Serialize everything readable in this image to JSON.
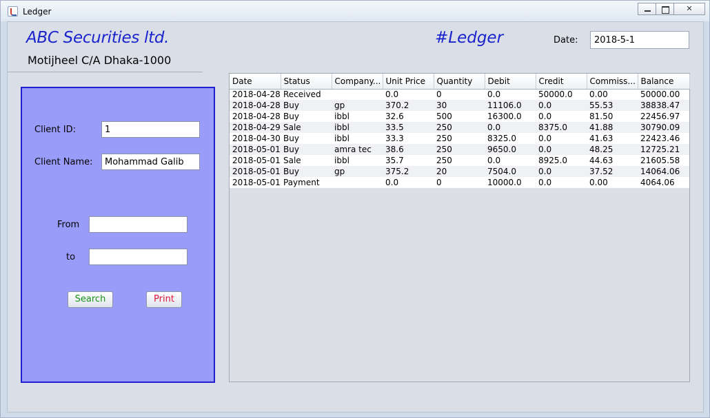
{
  "window": {
    "title": "Ledger"
  },
  "header": {
    "company_name": "ABC Securities ltd.",
    "company_address": "Motijheel C/A Dhaka-1000",
    "screen_title": "#Ledger",
    "date_label": "Date:",
    "date_value": "2018-5-1"
  },
  "form": {
    "client_id_label": "Client ID:",
    "client_id_value": "1",
    "client_name_label": "Client Name:",
    "client_name_value": "Mohammad Galib",
    "from_label": "From",
    "from_value": "",
    "to_label": "to",
    "to_value": "",
    "search_label": "Search",
    "print_label": "Print"
  },
  "colors": {
    "brand_blue": "#1a23cc",
    "panel_bg": "#9a9cf9",
    "search_green": "#1a8f1a",
    "print_red": "#e0143c"
  },
  "table": {
    "columns": [
      "Date",
      "Status",
      "Company...",
      "Unit Price",
      "Quantity",
      "Debit",
      "Credit",
      "Commiss...",
      "Balance"
    ],
    "rows": [
      [
        "2018-04-28",
        "Received",
        "",
        "0.0",
        "0",
        "0.0",
        "50000.0",
        "0.00",
        "50000.00"
      ],
      [
        "2018-04-28",
        "Buy",
        "gp",
        "370.2",
        "30",
        "11106.0",
        "0.0",
        "55.53",
        "38838.47"
      ],
      [
        "2018-04-28",
        "Buy",
        "ibbl",
        "32.6",
        "500",
        "16300.0",
        "0.0",
        "81.50",
        "22456.97"
      ],
      [
        "2018-04-29",
        "Sale",
        "ibbl",
        "33.5",
        "250",
        "0.0",
        "8375.0",
        "41.88",
        "30790.09"
      ],
      [
        "2018-04-30",
        "Buy",
        "ibbl",
        "33.3",
        "250",
        "8325.0",
        "0.0",
        "41.63",
        "22423.46"
      ],
      [
        "2018-05-01",
        "Buy",
        "amra tec",
        "38.6",
        "250",
        "9650.0",
        "0.0",
        "48.25",
        "12725.21"
      ],
      [
        "2018-05-01",
        "Sale",
        "ibbl",
        "35.7",
        "250",
        "0.0",
        "8925.0",
        "44.63",
        "21605.58"
      ],
      [
        "2018-05-01",
        "Buy",
        "gp",
        "375.2",
        "20",
        "7504.0",
        "0.0",
        "37.52",
        "14064.06"
      ],
      [
        "2018-05-01",
        "Payment",
        "",
        "0.0",
        "0",
        "10000.0",
        "0.0",
        "0.00",
        "4064.06"
      ]
    ]
  }
}
